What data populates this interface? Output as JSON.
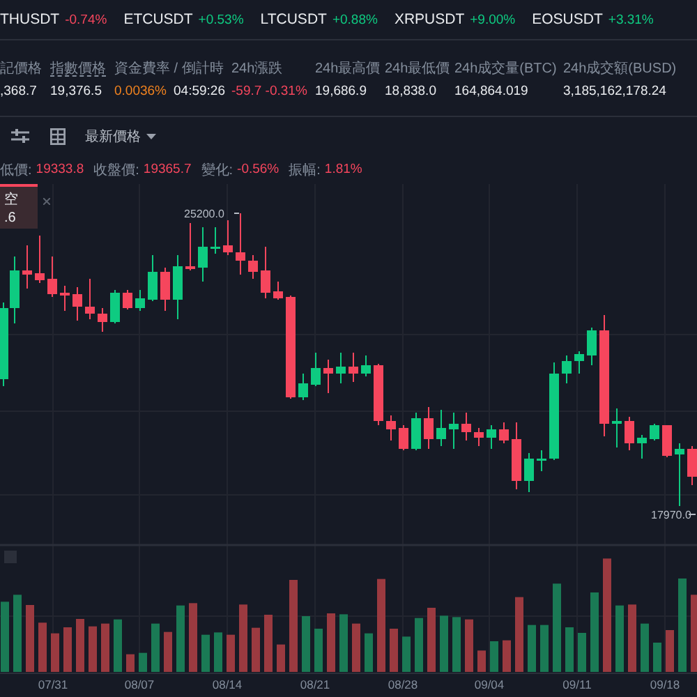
{
  "tickers": [
    {
      "symbol": "THUSDT",
      "change": "-0.74%",
      "rising": false
    },
    {
      "symbol": "ETCUSDT",
      "change": "+0.53%",
      "rising": true
    },
    {
      "symbol": "LTCUSDT",
      "change": "+0.88%",
      "rising": true
    },
    {
      "symbol": "XRPUSDT",
      "change": "+9.00%",
      "rising": true
    },
    {
      "symbol": "EOSUSDT",
      "change": "+3.31%",
      "rising": true
    }
  ],
  "stats": [
    {
      "label": "記價格",
      "underlined": false,
      "values": [
        {
          "text": ",368.7",
          "color": "#eaecef"
        }
      ]
    },
    {
      "label": "指數價格",
      "underlined": true,
      "values": [
        {
          "text": "19,376.5",
          "color": "#eaecef"
        }
      ]
    },
    {
      "label": "資金費率 / 倒計時",
      "underlined": false,
      "values": [
        {
          "text": "0.0036%",
          "color": "#f0821f"
        },
        {
          "text": "04:59:26",
          "color": "#eaecef"
        }
      ]
    },
    {
      "label": "24h漲跌",
      "underlined": false,
      "values": [
        {
          "text": "-59.7 -0.31%",
          "color": "#f6465d"
        }
      ]
    },
    {
      "label": "24h最高價",
      "underlined": false,
      "values": [
        {
          "text": "19,686.9",
          "color": "#eaecef"
        }
      ]
    },
    {
      "label": "24h最低價",
      "underlined": false,
      "values": [
        {
          "text": "18,838.0",
          "color": "#eaecef"
        }
      ]
    },
    {
      "label": "24h成交量(BTC)",
      "underlined": false,
      "values": [
        {
          "text": "164,864.019",
          "color": "#eaecef"
        }
      ]
    },
    {
      "label": "24h成交額(BUSD)",
      "underlined": false,
      "values": [
        {
          "text": "3,185,162,178.24",
          "color": "#eaecef"
        }
      ]
    }
  ],
  "toolbar": {
    "price_type": "最新價格"
  },
  "info_line": [
    {
      "label": "低價:",
      "value": "19333.8"
    },
    {
      "label": "收盤價:",
      "value": "19365.7"
    },
    {
      "label": "變化:",
      "value": "-0.56%"
    },
    {
      "label": "振幅:",
      "value": "1.81%"
    }
  ],
  "legend": {
    "lines": [
      "空",
      ".6"
    ]
  },
  "chart": {
    "high_label": "25200.0",
    "low_label": "17970.0",
    "x_labels": [
      "07/31",
      "08/07",
      "08/14",
      "08/21",
      "08/28",
      "09/04",
      "09/11",
      "09/18"
    ]
  }
}
